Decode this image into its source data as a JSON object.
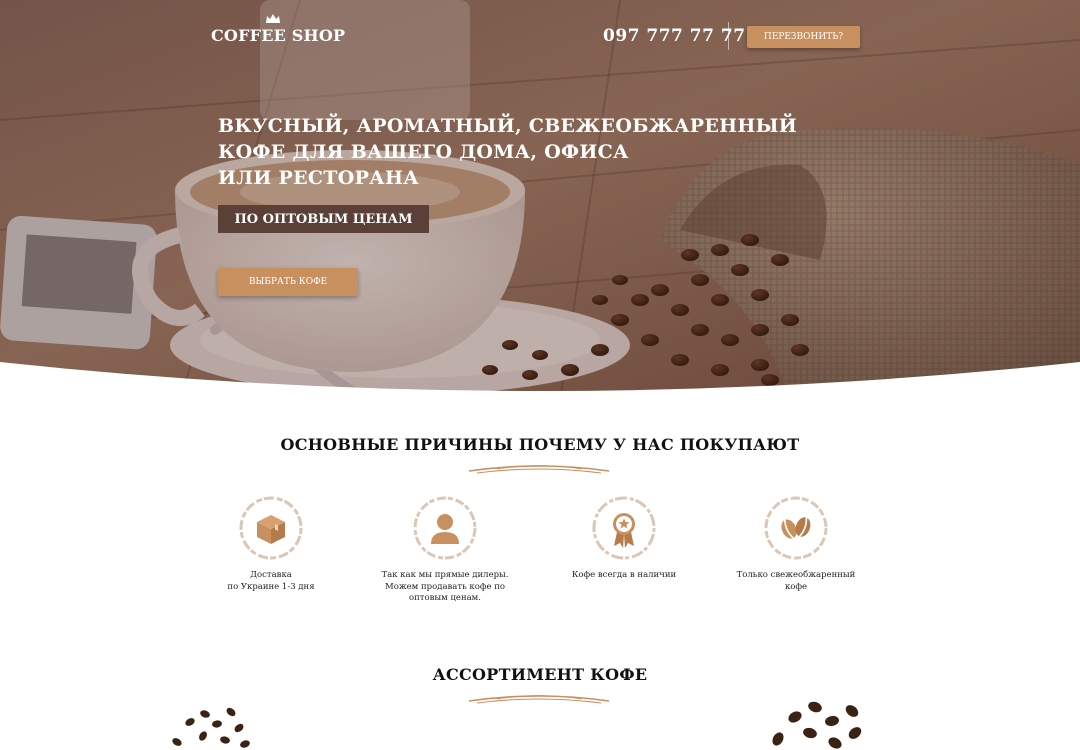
{
  "header": {
    "logo_text": "COFFEE SHOP",
    "phone": "097 777 77 77",
    "callback_label": "ПЕРЕЗВОНИТЬ?"
  },
  "hero": {
    "title_lines": [
      "ВКУСНЫЙ, АРОМАТНЫЙ, СВЕЖЕОБЖАРЕННЫЙ",
      "КОФЕ ДЛЯ ВАШЕГО ДОМА, ОФИСА",
      "ИЛИ РЕСТОРАНА"
    ],
    "price_badge": "ПО ОПТОВЫМ ЦЕНАМ",
    "choose_label": "ВЫБРАТЬ КОФЕ"
  },
  "reasons": {
    "title": "ОСНОВНЫЕ ПРИЧИНЫ ПОЧЕМУ У НАС ПОКУПАЮТ",
    "items": [
      {
        "icon": "box-icon",
        "lines": [
          "Доставка",
          "по Украине 1-3 дня"
        ]
      },
      {
        "icon": "person-icon",
        "lines": [
          "Так как мы прямые дилеры.",
          "Можем продавать кофе по",
          "оптовым ценам."
        ]
      },
      {
        "icon": "medal-icon",
        "lines": [
          "Кофе всегда в наличии"
        ]
      },
      {
        "icon": "coffee-beans-icon",
        "lines": [
          "Только свежеобжаренный",
          "кофе"
        ]
      }
    ]
  },
  "assortment": {
    "title": "АССОРТИМЕНТ КОФЕ"
  },
  "colors": {
    "accent": "#c9905f",
    "badge": "#5a4036",
    "icon_ring": "#dcc6b4"
  }
}
